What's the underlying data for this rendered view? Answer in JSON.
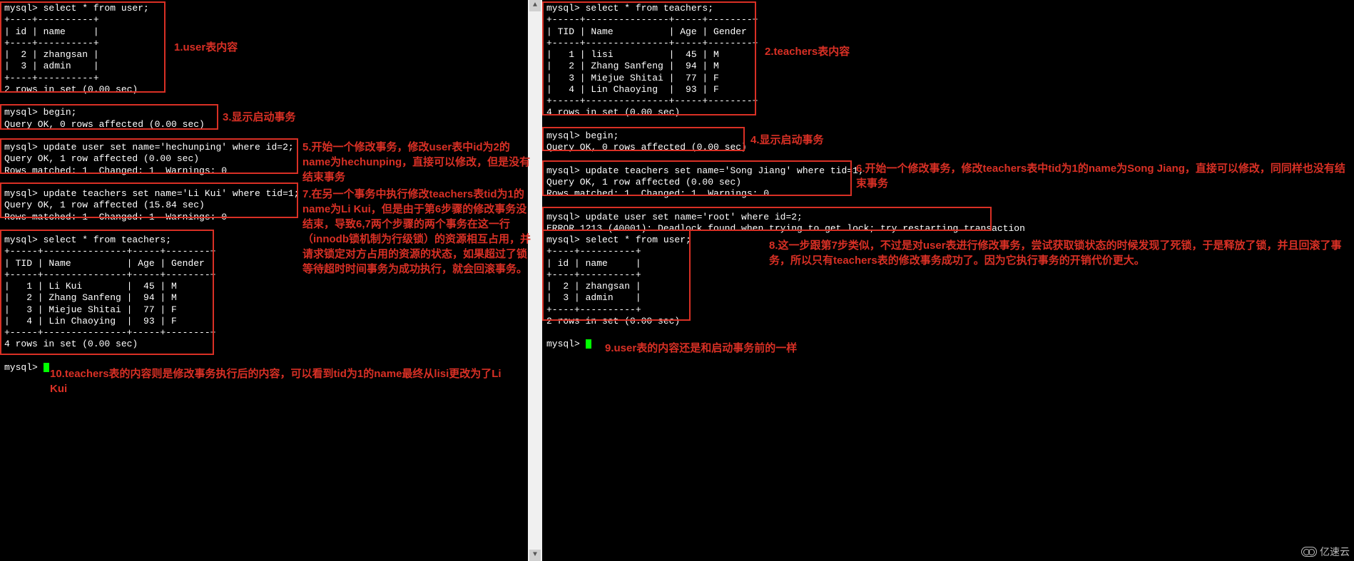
{
  "left": {
    "q1": "mysql> select * from user;",
    "user_table": [
      "+----+----------+",
      "| id | name     |",
      "+----+----------+",
      "|  2 | zhangsan |",
      "|  3 | admin    |",
      "+----+----------+",
      "2 rows in set (0.00 sec)"
    ],
    "begin1": "mysql> begin;",
    "begin1_res": "Query OK, 0 rows affected (0.00 sec)",
    "upd_user": "mysql> update user set name='hechunping' where id=2;",
    "upd_user_res1": "Query OK, 1 row affected (0.00 sec)",
    "upd_user_res2": "Rows matched: 1  Changed: 1  Warnings: 0",
    "upd_teach": "mysql> update teachers set name='Li Kui' where tid=1;",
    "upd_teach_res1": "Query OK, 1 row affected (15.84 sec)",
    "upd_teach_res2": "Rows matched: 1  Changed: 1  Warnings: 0",
    "q_teach": "mysql> select * from teachers;",
    "teach_table": [
      "+-----+---------------+-----+--------+",
      "| TID | Name          | Age | Gender |",
      "+-----+---------------+-----+--------+",
      "|   1 | Li Kui        |  45 | M      |",
      "|   2 | Zhang Sanfeng |  94 | M      |",
      "|   3 | Miejue Shitai |  77 | F      |",
      "|   4 | Lin Chaoying  |  93 | F      |",
      "+-----+---------------+-----+--------+",
      "4 rows in set (0.00 sec)"
    ],
    "prompt_end": "mysql> "
  },
  "right": {
    "q_teach": "mysql> select * from teachers;",
    "teach_table": [
      "+-----+---------------+-----+--------+",
      "| TID | Name          | Age | Gender |",
      "+-----+---------------+-----+--------+",
      "|   1 | lisi          |  45 | M      |",
      "|   2 | Zhang Sanfeng |  94 | M      |",
      "|   3 | Miejue Shitai |  77 | F      |",
      "|   4 | Lin Chaoying  |  93 | F      |",
      "+-----+---------------+-----+--------+",
      "4 rows in set (0.00 sec)"
    ],
    "begin1": "mysql> begin;",
    "begin1_res": "Query OK, 0 rows affected (0.00 sec)",
    "upd_teach": "mysql> update teachers set name='Song Jiang' where tid=1;",
    "upd_teach_res1": "Query OK, 1 row affected (0.00 sec)",
    "upd_teach_res2": "Rows matched: 1  Changed: 1  Warnings: 0",
    "upd_user": "mysql> update user set name='root' where id=2;",
    "upd_user_err": "ERROR 1213 (40001): Deadlock found when trying to get lock; try restarting transaction",
    "q_user": "mysql> select * from user;",
    "user_table": [
      "+----+----------+",
      "| id | name     |",
      "+----+----------+",
      "|  2 | zhangsan |",
      "|  3 | admin    |",
      "+----+----------+",
      "2 rows in set (0.00 sec)"
    ],
    "prompt_end": "mysql> "
  },
  "annotations": {
    "a1": "1.user表内容",
    "a2": "2.teachers表内容",
    "a3": "3.显示启动事务",
    "a4": "4.显示启动事务",
    "a5": "5.开始一个修改事务，修改user表中id为2的name为hechunping，直接可以修改，但是没有结束事务",
    "a6": "6.开始一个修改事务，修改teachers表中tid为1的name为Song Jiang，直接可以修改，同同样也没有结束事务",
    "a7": "7.在另一个事务中执行修改teachers表tid为1的name为Li Kui，但是由于第6步骤的修改事务没结束，导致6,7两个步骤的两个事务在这一行（innodb锁机制为行级锁）的资源相互占用，并请求锁定对方占用的资源的状态，如果超过了锁等待超时时间事务为成功执行，就会回滚事务。",
    "a8": "8.这一步跟第7步类似，不过是对user表进行修改事务，尝试获取锁状态的时候发现了死锁，于是释放了锁，并且回滚了事务，所以只有teachers表的修改事务成功了。因为它执行事务的开销代价更大。",
    "a9": "9.user表的内容还是和启动事务前的一样",
    "a10": "10.teachers表的内容则是修改事务执行后的内容，可以看到tid为1的name最终从lisi更改为了Li Kui"
  },
  "watermark": "亿速云",
  "scroll": {
    "up": "▲",
    "down": "▼"
  }
}
